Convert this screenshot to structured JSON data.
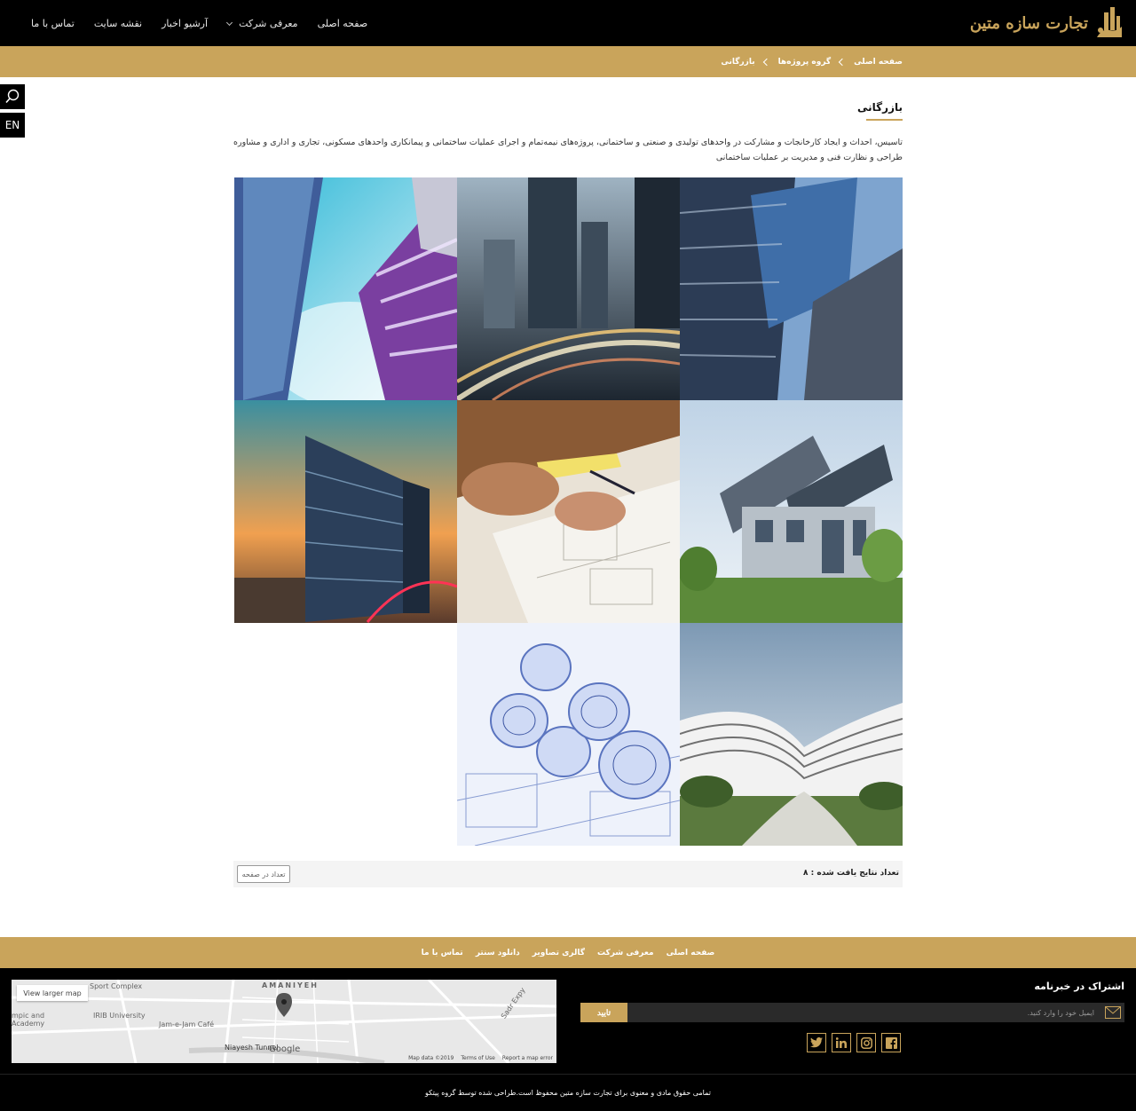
{
  "brand": {
    "name": "تجارت سازه متین",
    "accent": "#c9a45b",
    "dark": "#000000"
  },
  "nav": {
    "items": [
      {
        "label": "صفحه اصلی",
        "has_dropdown": false
      },
      {
        "label": "معرفی شرکت",
        "has_dropdown": true
      },
      {
        "label": "آرشیو اخبار",
        "has_dropdown": false
      },
      {
        "label": "نقشه سایت",
        "has_dropdown": false
      },
      {
        "label": "تماس با ما",
        "has_dropdown": false
      }
    ]
  },
  "breadcrumb": [
    "صفحه اصلی",
    "گروه پروژه‌ها",
    "بازرگانی"
  ],
  "side": {
    "search_icon": "search-icon",
    "lang_label": "EN"
  },
  "page": {
    "title": "بازرگانی",
    "description": "تاسیس، احداث و ایجاد کارخانجات و مشارکت در واحدهای تولیدی و صنعتی و ساختمانی، پروژه‌های نیمه‌تمام و اجرای عملیات ساختمانی و پیمانکاری واحدهای مسکونی، تجاری و اداری و مشاوره طراحی و نظارت فنی و مدیریت بر عملیات ساختمانی"
  },
  "gallery": {
    "tiles": [
      {
        "subject": "glass-towers-sky"
      },
      {
        "subject": "night-traffic-city"
      },
      {
        "subject": "skyscrapers-blue"
      },
      {
        "subject": "sunset-glass-building"
      },
      {
        "subject": "architect-drawing"
      },
      {
        "subject": "modern-house"
      },
      {
        "subject": "blueprint-rolls"
      },
      {
        "subject": "curved-architecture"
      }
    ]
  },
  "results": {
    "count_label": "تعداد نتایج یافت شده : ۸",
    "per_page_label": "تعداد در صفحه"
  },
  "footer_nav": [
    "صفحه اصلی",
    "معرفی شرکت",
    "گالری تصاویر",
    "دانلود سنتر",
    "تماس با ما"
  ],
  "map": {
    "larger_map": "View larger map",
    "labels": [
      "AMANIYEH",
      "Sport Complex",
      "IRIB University",
      "Jam-e-Jam Café",
      "Niayesh Tunnel",
      "Sadr Expy",
      "mpic and Academy"
    ],
    "google": "Google",
    "credits": [
      "Map data ©2019",
      "Terms of Use",
      "Report a map error"
    ]
  },
  "newsletter": {
    "title": "اشتراک در خبرنامه",
    "placeholder": "ایمیل خود را وارد کنید.",
    "submit": "تایید"
  },
  "social": [
    "twitter-icon",
    "linkedin-icon",
    "instagram-icon",
    "facebook-icon"
  ],
  "copyright": "تمامی حقوق مادی و معنوی برای تجارت سازه متین محفوظ است.طراحی شده توسط گروه پیتکو"
}
